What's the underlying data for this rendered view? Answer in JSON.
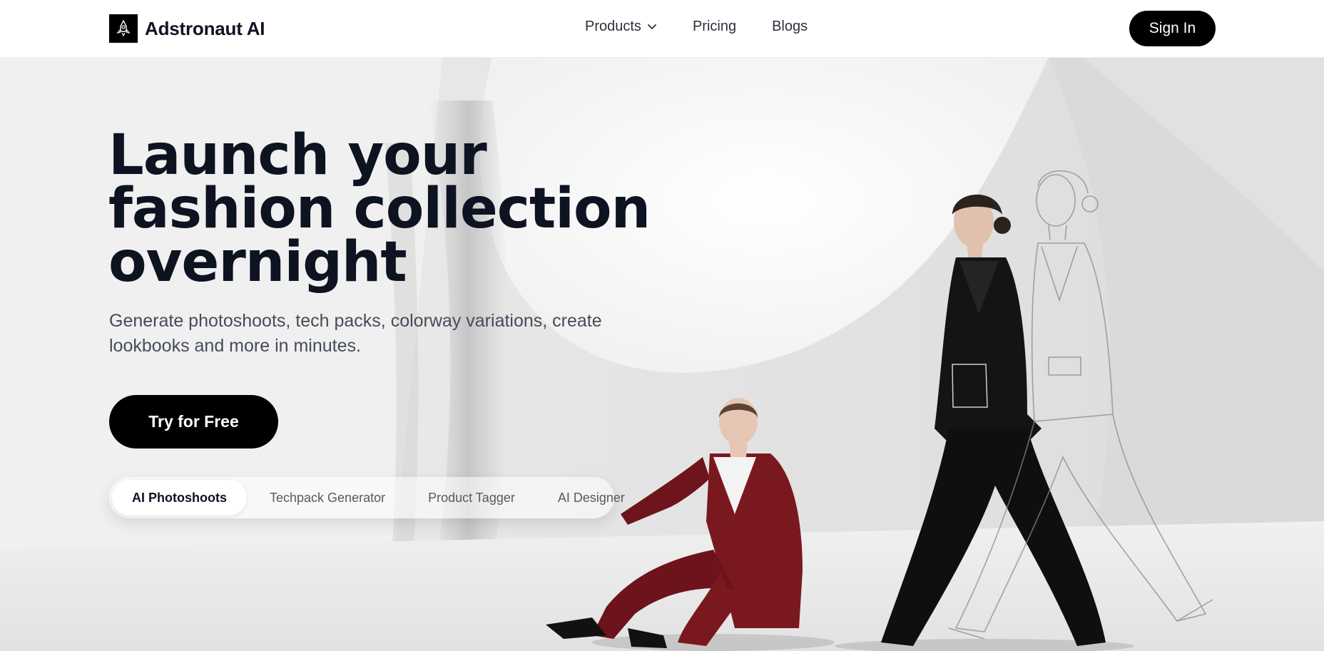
{
  "brand": {
    "name": "Adstronaut AI",
    "logo_icon": "rocket-logo-icon"
  },
  "nav": {
    "links": [
      {
        "label": "Products",
        "has_dropdown": true
      },
      {
        "label": "Pricing"
      },
      {
        "label": "Blogs"
      }
    ],
    "signin_label": "Sign In"
  },
  "hero": {
    "headline_lines": [
      "Launch your",
      "fashion collection",
      "overnight"
    ],
    "subtitle_lines": [
      "Generate photoshoots, tech packs, colorway variations, create",
      "lookbooks and more in minutes."
    ],
    "cta_label": "Try for Free",
    "tabs": [
      {
        "label": "AI Photoshoots",
        "active": true
      },
      {
        "label": "Techpack Generator"
      },
      {
        "label": "Product Tagger"
      },
      {
        "label": "AI Designer"
      }
    ]
  },
  "colors": {
    "primary": "#000000",
    "heading": "#0d1320",
    "body_text": "#454c5a",
    "suit_red": "#7a1820",
    "background": "#e6e6e6"
  }
}
